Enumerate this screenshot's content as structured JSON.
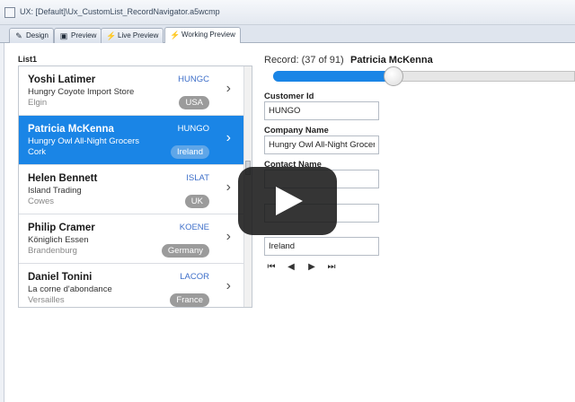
{
  "window": {
    "title": "UX: [Default]\\Ux_CustomList_RecordNavigator.a5wcmp"
  },
  "tabs": [
    {
      "label": "Design",
      "icon": "design-icon"
    },
    {
      "label": "Preview",
      "icon": "preview-icon"
    },
    {
      "label": "Live Preview",
      "icon": "lightning-icon"
    },
    {
      "label": "Working Preview",
      "icon": "lightning-icon",
      "active": true
    }
  ],
  "list": {
    "label": "List1",
    "items": [
      {
        "name": "Yoshi Latimer",
        "company": "Hungry Coyote Import Store",
        "city": "Elgin",
        "code": "HUNGC",
        "country": "USA"
      },
      {
        "name": "Patricia McKenna",
        "company": "Hungry Owl All-Night Grocers",
        "city": "Cork",
        "code": "HUNGO",
        "country": "Ireland",
        "selected": true
      },
      {
        "name": "Helen Bennett",
        "company": "Island Trading",
        "city": "Cowes",
        "code": "ISLAT",
        "country": "UK"
      },
      {
        "name": "Philip Cramer",
        "company": "Königlich Essen",
        "city": "Brandenburg",
        "code": "KOENE",
        "country": "Germany"
      },
      {
        "name": "Daniel Tonini",
        "company": "La corne d'abondance",
        "city": "Versailles",
        "code": "LACOR",
        "country": "France"
      }
    ]
  },
  "record": {
    "label": "Record: (37 of 91)",
    "name": "Patricia McKenna",
    "current": 37,
    "total": 91
  },
  "form": {
    "customer_id": {
      "label": "Customer Id",
      "value": "HUNGO"
    },
    "company_name": {
      "label": "Company Name",
      "value": "Hungry Owl All-Night Grocers"
    },
    "contact_name": {
      "label": "Contact Name",
      "value": ""
    },
    "field4": {
      "value": ""
    },
    "country": {
      "value": "Ireland"
    }
  },
  "nav_icons": [
    "first-record-icon",
    "previous-record-icon",
    "next-record-icon",
    "last-record-icon"
  ],
  "colors": {
    "accent": "#1a85e6",
    "code_text": "#3e6fc9",
    "badge": "#9b9b9b"
  }
}
